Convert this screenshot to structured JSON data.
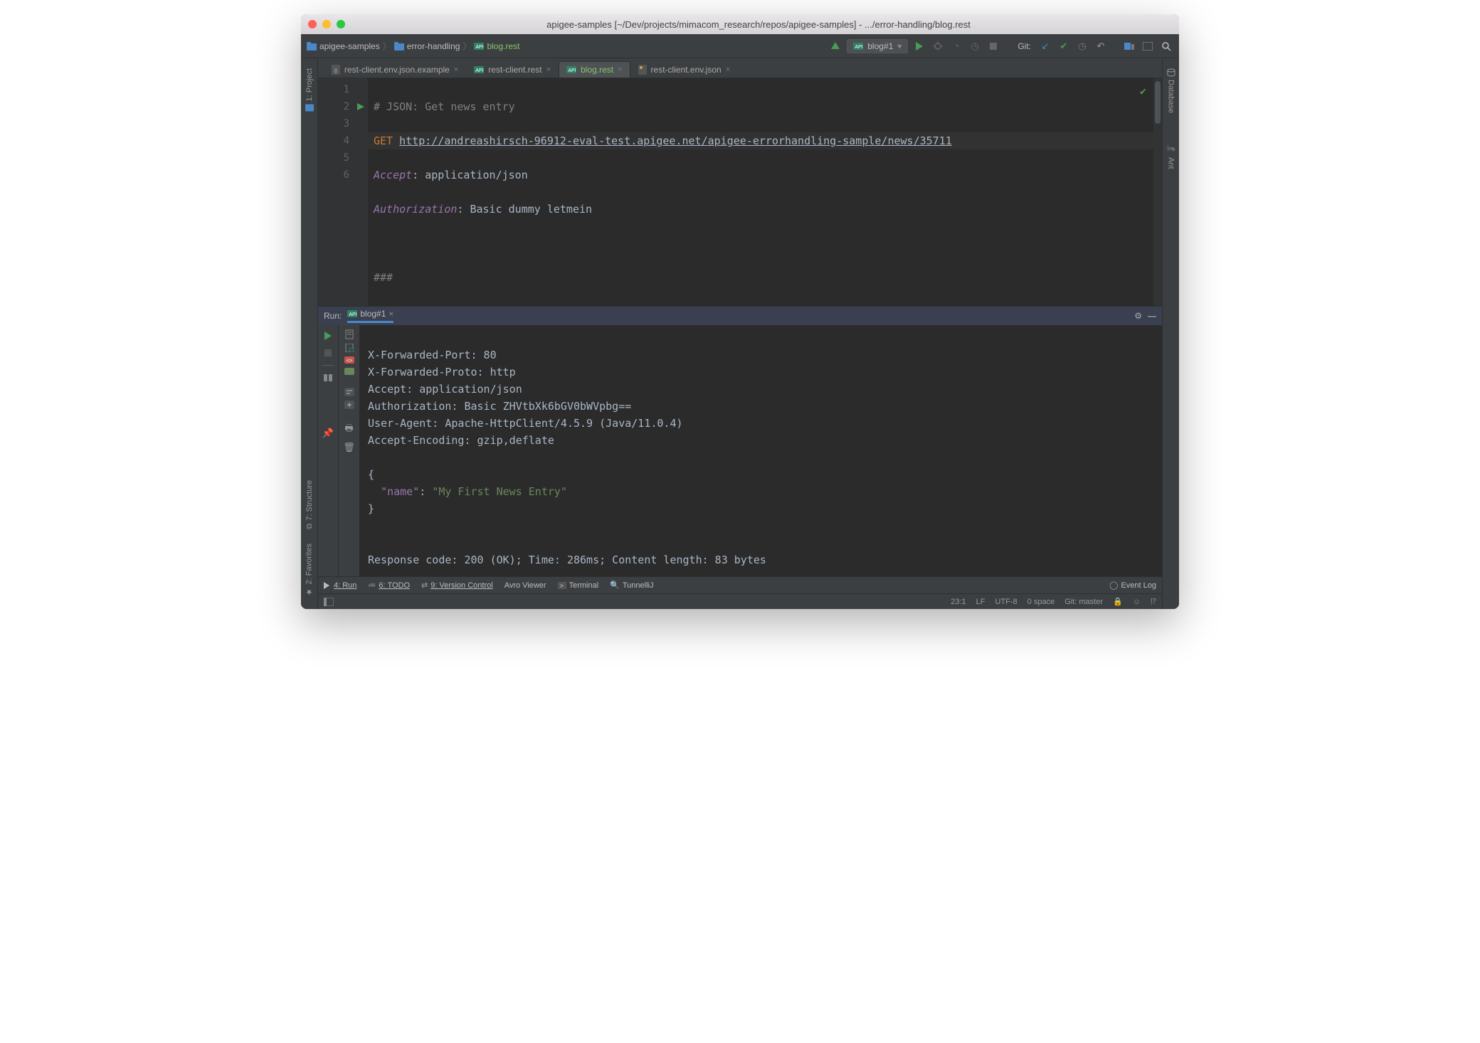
{
  "window": {
    "title": "apigee-samples [~/Dev/projects/mimacom_research/repos/apigee-samples] - .../error-handling/blog.rest"
  },
  "breadcrumb": {
    "root": "apigee-samples",
    "folder": "error-handling",
    "file": "blog.rest"
  },
  "run_config": {
    "label": "blog#1"
  },
  "toolbar": {
    "git_label": "Git:"
  },
  "tabs": [
    {
      "label": "rest-client.env.json.example"
    },
    {
      "label": "rest-client.rest"
    },
    {
      "label": "blog.rest",
      "active": true
    },
    {
      "label": "rest-client.env.json"
    }
  ],
  "editor": {
    "lines": [
      "1",
      "2",
      "3",
      "4",
      "5",
      "6"
    ],
    "code": {
      "comment": "# JSON: Get news entry",
      "method": "GET",
      "url": "http://andreashirsch-96912-eval-test.apigee.net/apigee-errorhandling-sample/news/35711",
      "h1_name": "Accept",
      "h1_val": ": application/json",
      "h2_name": "Authorization",
      "h2_val": ": Basic dummy letmein",
      "sep": "###"
    }
  },
  "side_tabs": {
    "project": "1: Project",
    "structure": "7: Structure",
    "favorites": "2: Favorites",
    "database": "Database",
    "ant": "Ant"
  },
  "run_panel": {
    "title": "Run:",
    "tab": "blog#1",
    "output_lines": [
      "X-Forwarded-Port: 80",
      "X-Forwarded-Proto: http",
      "Accept: application/json",
      "Authorization: Basic ZHVtbXk6bGV0bWVpbg==",
      "User-Agent: Apache-HttpClient/4.5.9 (Java/11.0.4)",
      "Accept-Encoding: gzip,deflate"
    ],
    "json_open": "{",
    "json_key": "\"name\"",
    "json_colon": ": ",
    "json_val": "\"My First News Entry\"",
    "json_close": "}",
    "summary": "Response code: 200 (OK); Time: 286ms; Content length: 83 bytes"
  },
  "bottom": {
    "run": "4: Run",
    "todo": "6: TODO",
    "vcs": "9: Version Control",
    "avro": "Avro Viewer",
    "terminal": "Terminal",
    "tunnel": "TunnelliJ",
    "event_log": "Event Log"
  },
  "status": {
    "cursor": "23:1",
    "line_end": "LF",
    "encoding": "UTF-8",
    "indent": "0 space",
    "git": "Git: master"
  }
}
